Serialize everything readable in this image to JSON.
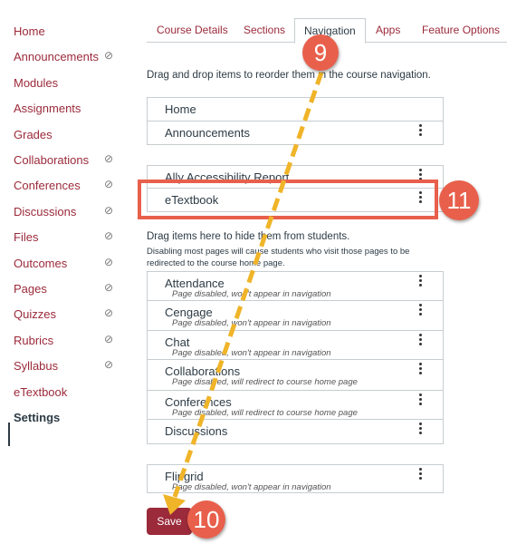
{
  "sidebar": {
    "items": [
      {
        "label": "Home",
        "hidden": false
      },
      {
        "label": "Announcements",
        "hidden": true
      },
      {
        "label": "Modules",
        "hidden": false
      },
      {
        "label": "Assignments",
        "hidden": false
      },
      {
        "label": "Grades",
        "hidden": false
      },
      {
        "label": "Collaborations",
        "hidden": true
      },
      {
        "label": "Conferences",
        "hidden": true
      },
      {
        "label": "Discussions",
        "hidden": true
      },
      {
        "label": "Files",
        "hidden": true
      },
      {
        "label": "Outcomes",
        "hidden": true
      },
      {
        "label": "Pages",
        "hidden": true
      },
      {
        "label": "Quizzes",
        "hidden": true
      },
      {
        "label": "Rubrics",
        "hidden": true
      },
      {
        "label": "Syllabus",
        "hidden": true
      },
      {
        "label": "eTextbook",
        "hidden": false
      },
      {
        "label": "Settings",
        "hidden": false,
        "active": true
      }
    ],
    "hidden_icon": "eye-slash-icon"
  },
  "tabs": [
    "Course Details",
    "Sections",
    "Navigation",
    "Apps",
    "Feature Options"
  ],
  "active_tab": "Navigation",
  "enabled": {
    "instruction": "Drag and drop items to reorder them in the course navigation.",
    "items": [
      "Home",
      "Announcements",
      "Ally Accessibility Report",
      "eTextbook"
    ]
  },
  "disabled": {
    "instruction": "Drag items here to hide them from students.",
    "note": "Disabling most pages will cause students who visit those pages to be redirected to the course home page.",
    "items": [
      {
        "name": "Attendance",
        "status": "Page disabled, won't appear in navigation"
      },
      {
        "name": "Cengage",
        "status": "Page disabled, won't appear in navigation"
      },
      {
        "name": "Chat",
        "status": "Page disabled, won't appear in navigation"
      },
      {
        "name": "Collaborations",
        "status": "Page disabled, will redirect to course home page"
      },
      {
        "name": "Conferences",
        "status": "Page disabled, will redirect to course home page"
      },
      {
        "name": "Discussions",
        "status": ""
      },
      {
        "name": "Flipgrid",
        "status": "Page disabled, won't appear in navigation"
      }
    ]
  },
  "save_label": "Save",
  "annotations": [
    "9",
    "10",
    "11"
  ],
  "colors": {
    "brand": "#9b2a3a",
    "annotation": "#e8604c",
    "arrow": "#f0b429"
  }
}
